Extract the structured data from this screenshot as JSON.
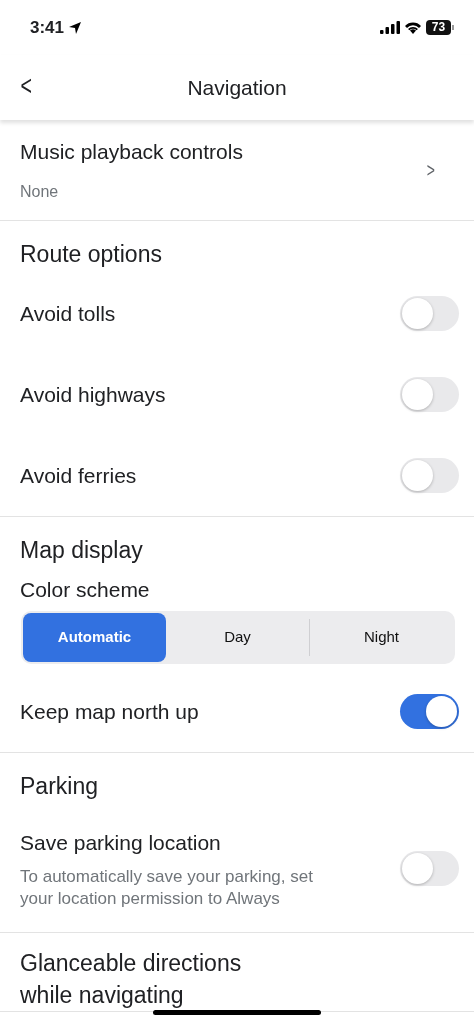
{
  "status_bar": {
    "time": "3:41",
    "battery": "73"
  },
  "header": {
    "back": "<",
    "title": "Navigation"
  },
  "sections": [
    {
      "items": [
        {
          "kind": "link",
          "label": "Music playback controls",
          "value": "None",
          "chevron": ">"
        }
      ]
    },
    {
      "title": "Route options",
      "items": [
        {
          "kind": "toggle",
          "label": "Avoid tolls",
          "on": false
        },
        {
          "kind": "toggle",
          "label": "Avoid highways",
          "on": false
        },
        {
          "kind": "toggle",
          "label": "Avoid ferries",
          "on": false
        }
      ]
    },
    {
      "title": "Map display",
      "items": [
        {
          "kind": "segmented",
          "label": "Color scheme",
          "options": [
            {
              "label": "Automatic",
              "selected": true
            },
            {
              "label": "Day",
              "selected": false
            },
            {
              "label": "Night",
              "selected": false
            }
          ]
        },
        {
          "kind": "toggle",
          "label": "Keep map north up",
          "on": true
        }
      ]
    },
    {
      "title": "Parking",
      "items": [
        {
          "kind": "toggle",
          "label": "Save parking location",
          "description": "To automatically save your parking, set your location permission to Always",
          "on": false
        }
      ]
    },
    {
      "title": "Glanceable directions while navigating"
    }
  ]
}
